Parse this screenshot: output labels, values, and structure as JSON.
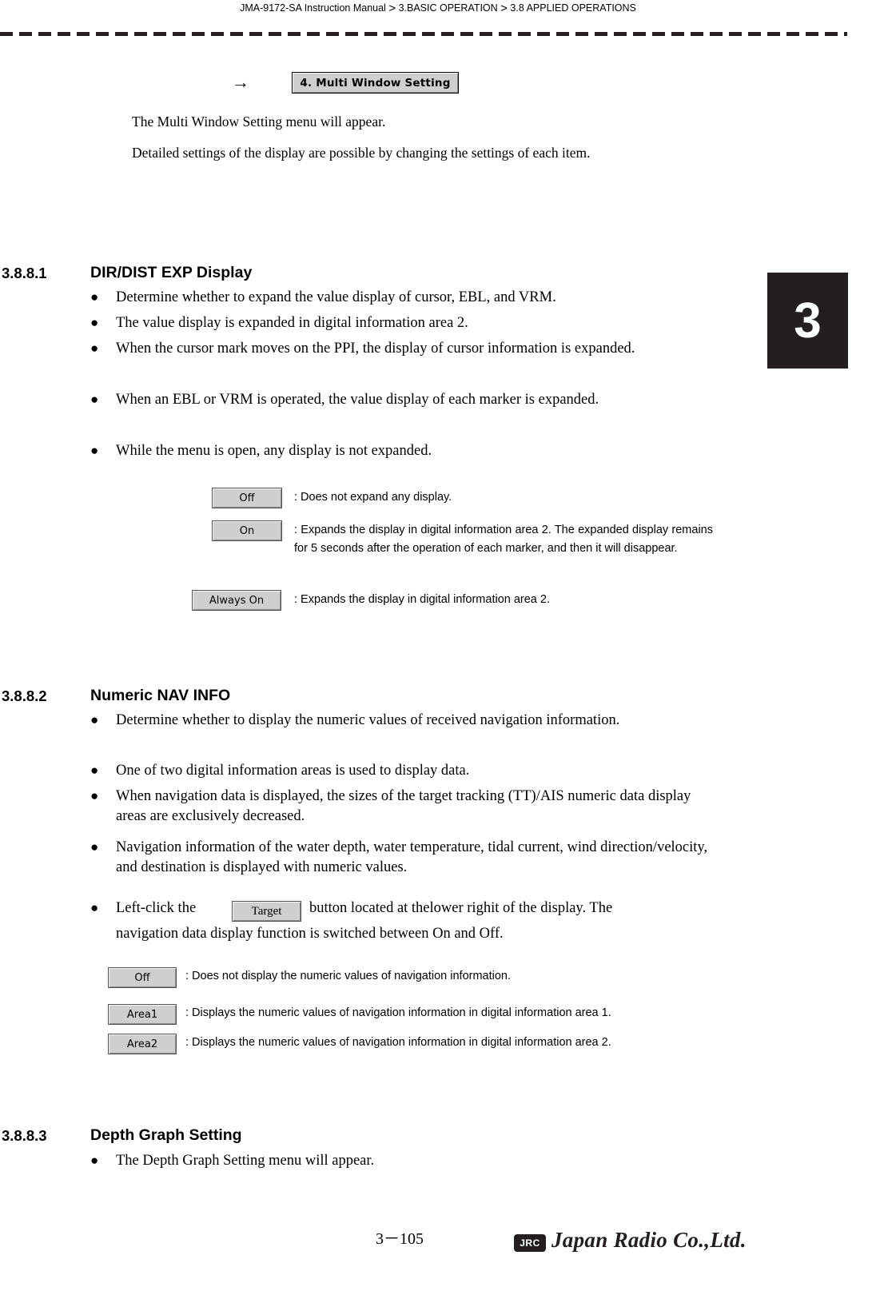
{
  "header": {
    "manual": "JMA-9172-SA Instruction Manual",
    "sep1": ">",
    "crumb1": "3.BASIC OPERATION",
    "sep2": ">",
    "crumb2": "3.8  APPLIED OPERATIONS"
  },
  "chapter_tab": "3",
  "intro": {
    "arrow": "→",
    "menu_button": "4. Multi Window Setting",
    "line1": "The Multi Window Setting menu will appear.",
    "line2": "Detailed settings of the display are possible by changing the settings of each item."
  },
  "section_1": {
    "number": "3.8.8.1",
    "title": "DIR/DIST EXP Display",
    "bullets": [
      "Determine whether to expand the value display of cursor, EBL, and VRM.",
      "The value display is expanded in digital information area 2.",
      "When the cursor mark moves on the PPI, the display of cursor information is expanded.",
      "When an EBL or VRM is operated, the value display of each marker is expanded.",
      "While the menu is open, any display is not expanded."
    ],
    "options": [
      {
        "key": "Off",
        "desc": ": Does not expand any display."
      },
      {
        "key": "On",
        "desc": ": Expands the display in digital information area 2. The expanded display remains for 5 seconds after the operation of each marker, and then it will disappear."
      },
      {
        "key": "Always On",
        "desc": ": Expands the display in digital information area 2."
      }
    ]
  },
  "section_2": {
    "number": "3.8.8.2",
    "title": "Numeric NAV INFO",
    "bullets": [
      "Determine whether to display the numeric values of received navigation information.",
      "One of two digital information areas is used to display data.",
      "When navigation data is displayed, the sizes of the target tracking (TT)/AIS numeric data display areas are exclusively decreased.",
      "Navigation information of the water depth, water temperature, tidal current, wind direction/velocity, and destination is displayed with numeric values."
    ],
    "bullet_target_pre": "Left-click the",
    "target_button": "Target",
    "bullet_target_post": "button located at thelower righit of the display. The",
    "bullet_target_line2": "navigation data display function is switched between On and Off.",
    "options": [
      {
        "key": "Off",
        "desc": ": Does not display the numeric values of navigation information."
      },
      {
        "key": "Area1",
        "desc": ": Displays the numeric values of navigation information in digital information area 1."
      },
      {
        "key": "Area2",
        "desc": ": Displays the numeric values of navigation information in digital information area 2."
      }
    ]
  },
  "section_3": {
    "number": "3.8.8.3",
    "title": "Depth Graph Setting",
    "bullets": [
      "The Depth Graph Setting menu will appear."
    ]
  },
  "footer": {
    "page": "3－105",
    "badge": "JRC",
    "company": "Japan Radio Co.,Ltd."
  }
}
